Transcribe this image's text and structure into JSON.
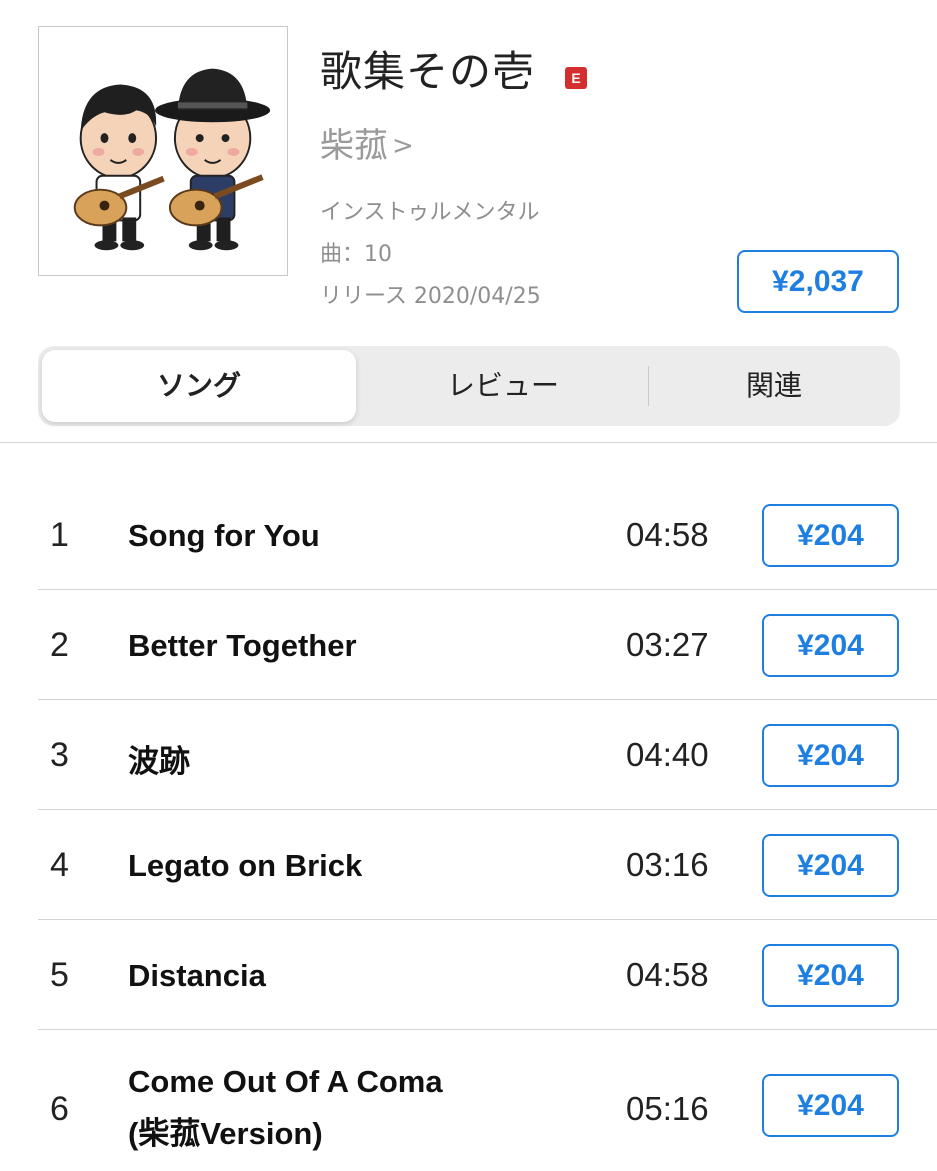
{
  "album": {
    "title": "歌集その壱",
    "explicit_badge": "E",
    "artist": "柴菰",
    "artist_chevron": ">",
    "genre": "インストゥルメンタル",
    "track_count": "曲：10",
    "release": "リリース 2020/04/25",
    "price": "¥2,037",
    "artwork_icon": "album-artwork-cartoon-guitarists"
  },
  "tabs": [
    {
      "label": "ソング",
      "selected": true
    },
    {
      "label": "レビュー",
      "selected": false
    },
    {
      "label": "関連",
      "selected": false
    }
  ],
  "tracks": [
    {
      "number": "1",
      "title": "Song for You",
      "title2": "",
      "duration": "04:58",
      "price": "¥204"
    },
    {
      "number": "2",
      "title": "Better Together",
      "title2": "",
      "duration": "03:27",
      "price": "¥204"
    },
    {
      "number": "3",
      "title": "波跡",
      "title2": "",
      "duration": "04:40",
      "price": "¥204"
    },
    {
      "number": "4",
      "title": "Legato on Brick",
      "title2": "",
      "duration": "03:16",
      "price": "¥204"
    },
    {
      "number": "5",
      "title": "Distancia",
      "title2": "",
      "duration": "04:58",
      "price": "¥204"
    },
    {
      "number": "6",
      "title": "Come Out Of A Coma",
      "title2": "(柴菰Version)",
      "duration": "05:16",
      "price": "¥204"
    }
  ],
  "colors": {
    "accent": "#1f7fe0",
    "explicit": "#d32f2f",
    "secondary_text": "#8f8f8f"
  }
}
